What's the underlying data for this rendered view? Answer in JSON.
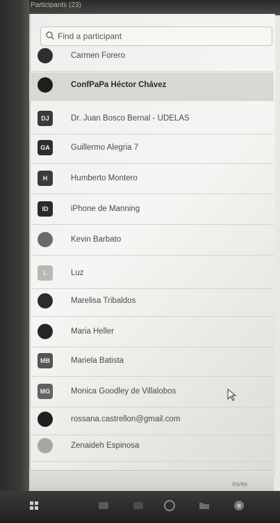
{
  "window": {
    "title": "Participants (23)"
  },
  "search": {
    "placeholder": "Find a participant"
  },
  "participants": [
    {
      "name": "Carmen Forero",
      "initials": "",
      "color": "#2f2f2f"
    },
    {
      "name": "ConfPaPa Héctor Chávez",
      "initials": "",
      "color": "#1e1e1e"
    },
    {
      "name": "Dr. Juan Bosco Bernal - UDELAS",
      "initials": "DJ",
      "color": "#3a3a3a"
    },
    {
      "name": "Guillermo Alegria 7",
      "initials": "GA",
      "color": "#2e2e2e"
    },
    {
      "name": "Humberto Montero",
      "initials": "H",
      "color": "#3b3b3b"
    },
    {
      "name": "iPhone de Manning",
      "initials": "ID",
      "color": "#2a2a2a"
    },
    {
      "name": "Kevin Barbato",
      "initials": "",
      "color": "#6a6a68"
    },
    {
      "name": "Luz",
      "initials": "L",
      "color": "#b7b7b3"
    },
    {
      "name": "Marelisa Tribaldos",
      "initials": "",
      "color": "#2c2c2c"
    },
    {
      "name": "Maria Heller",
      "initials": "",
      "color": "#262626"
    },
    {
      "name": "Mariela Batista",
      "initials": "MB",
      "color": "#555553"
    },
    {
      "name": "Monica Goodley de Villalobos",
      "initials": "MG",
      "color": "#616160"
    },
    {
      "name": "rossana.castrellon@gmail.com",
      "initials": "",
      "color": "#1f1f1f"
    },
    {
      "name": "Zenaideh Espinosa",
      "initials": "",
      "color": "#a6a6a2"
    }
  ],
  "selected_index": 1,
  "footer": {
    "invite_label": "Invite"
  }
}
